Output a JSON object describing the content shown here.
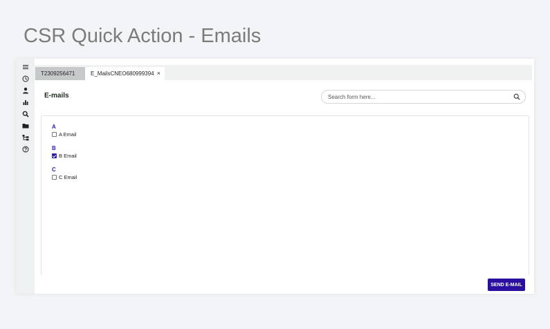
{
  "page": {
    "title": "CSR Quick Action - Emails"
  },
  "sidebar": {
    "icons": [
      "menu-icon",
      "history-icon",
      "user-icon",
      "chart-icon",
      "search-icon",
      "folder-icon",
      "hierarchy-icon",
      "help-icon"
    ]
  },
  "tabs": [
    {
      "label": "T2309256471",
      "active": false
    },
    {
      "label": "E_MailsCNEO680999394",
      "active": true,
      "close": "×"
    }
  ],
  "content": {
    "title": "E-mails",
    "search": {
      "placeholder": "Search form here...",
      "value": ""
    },
    "groups": [
      {
        "label": "A",
        "items": [
          {
            "label": "A Email",
            "checked": false
          }
        ]
      },
      {
        "label": "B",
        "items": [
          {
            "label": "B Email",
            "checked": true
          }
        ]
      },
      {
        "label": "C",
        "items": [
          {
            "label": "C Email",
            "checked": false
          }
        ]
      }
    ],
    "send_button": "SEND E-MAIL"
  },
  "colors": {
    "accent": "#2a0fa0",
    "group_label": "#2b1ea8",
    "title": "#7b7b7b"
  }
}
